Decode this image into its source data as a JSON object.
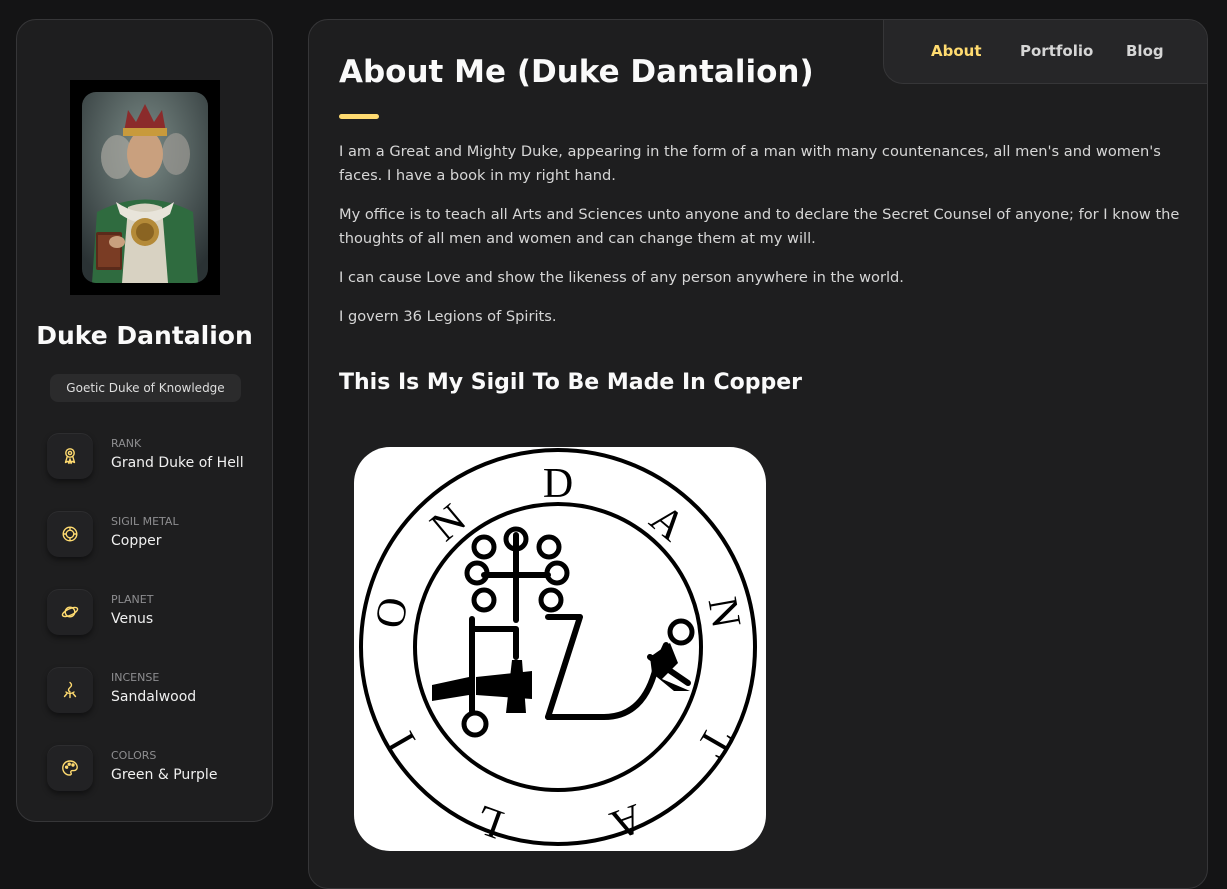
{
  "profile": {
    "name": "Duke Dantalion",
    "title": "Goetic Duke of Knowledge",
    "info": [
      {
        "label": "RANK",
        "value": "Grand Duke of Hell",
        "icon": "medal-icon"
      },
      {
        "label": "SIGIL METAL",
        "value": "Copper",
        "icon": "ring-icon"
      },
      {
        "label": "PLANET",
        "value": "Venus",
        "icon": "planet-icon"
      },
      {
        "label": "INCENSE",
        "value": "Sandalwood",
        "icon": "incense-icon"
      },
      {
        "label": "COLORS",
        "value": "Green & Purple",
        "icon": "palette-icon"
      }
    ]
  },
  "nav": {
    "items": [
      {
        "label": "About",
        "active": true
      },
      {
        "label": "Portfolio",
        "active": false
      },
      {
        "label": "Blog",
        "active": false
      }
    ]
  },
  "about": {
    "heading": "About Me (Duke Dantalion)",
    "paragraphs": [
      "I am a Great and Mighty Duke, appearing in the form of a man with many countenances, all men's and women's faces. I have a book in my right hand.",
      "My office is to teach all Arts and Sciences unto anyone and to declare the Secret Counsel of anyone; for I know the thoughts of all men and women and can change them at my will.",
      "I can cause Love and show the likeness of any person anywhere in the world.",
      "I govern 36 Legions of Spirits."
    ],
    "sigil_heading": "This Is My Sigil To Be Made In Copper",
    "sigil_letters": [
      "D",
      "A",
      "N",
      "T",
      "A",
      "L",
      "I",
      "O",
      "N"
    ]
  },
  "colors": {
    "accent": "#ffdb70",
    "background": "#141415",
    "card": "#1e1e1f"
  }
}
